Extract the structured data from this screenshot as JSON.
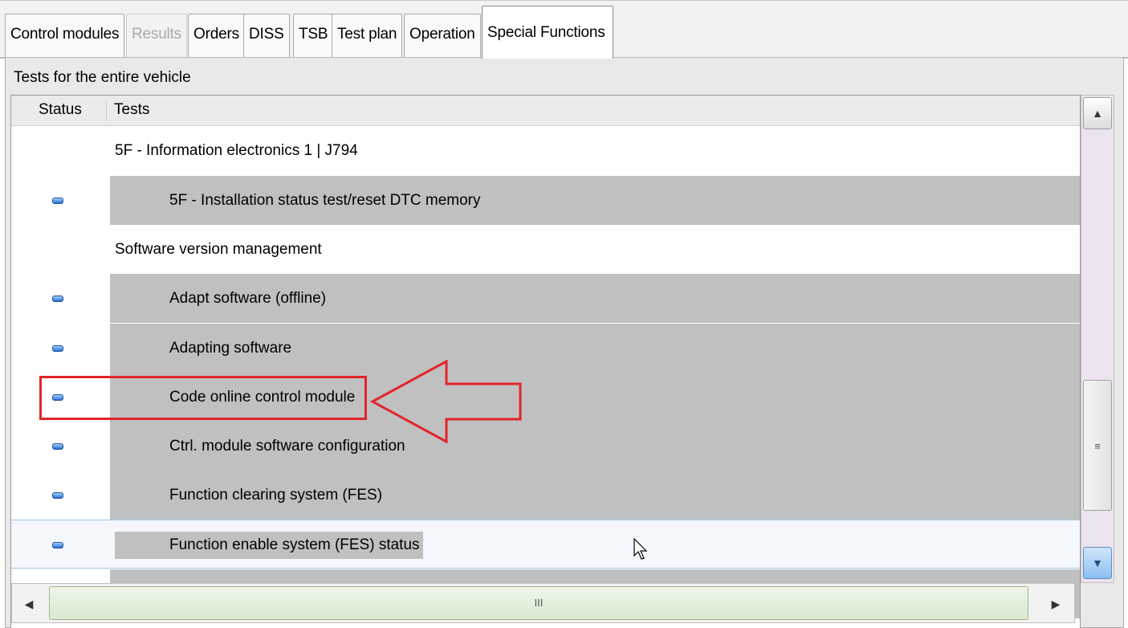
{
  "tabs": [
    {
      "label": "Control modules",
      "state": "normal"
    },
    {
      "label": "Results",
      "state": "disabled"
    },
    {
      "label": "Orders",
      "state": "normal"
    },
    {
      "label": "DISS",
      "state": "normal"
    },
    {
      "label": "TSB",
      "state": "normal"
    },
    {
      "label": "Test plan",
      "state": "normal"
    },
    {
      "label": "Operation",
      "state": "normal"
    },
    {
      "label": "Special Functions",
      "state": "active"
    }
  ],
  "panel": {
    "section_label": "Tests for the entire vehicle",
    "columns": {
      "status": "Status",
      "tests": "Tests"
    },
    "rows": [
      {
        "type": "group",
        "label": "5F - Information electronics 1 | J794"
      },
      {
        "type": "item",
        "label": "5F - Installation status test/reset DTC memory",
        "status": "blue-led"
      },
      {
        "type": "group",
        "label": "Software version management"
      },
      {
        "type": "item",
        "label": "Adapt software (offline)",
        "status": "blue-led"
      },
      {
        "type": "item",
        "label": "Adapting software",
        "status": "blue-led"
      },
      {
        "type": "item",
        "label": "Code online control module",
        "status": "blue-led",
        "annotated": true
      },
      {
        "type": "item",
        "label": "Ctrl. module software configuration",
        "status": "blue-led"
      },
      {
        "type": "item",
        "label": "Function clearing system (FES)",
        "status": "blue-led"
      },
      {
        "type": "item",
        "label": "Function enable system (FES) status",
        "status": "blue-led",
        "selected": true
      }
    ]
  },
  "scrollbars": {
    "vertical": {
      "up_icon": "chevron-up-icon",
      "down_icon": "chevron-down-icon",
      "thumb_grip": "≡"
    },
    "horizontal": {
      "left_icon": "arrow-left-icon",
      "right_icon": "arrow-right-icon",
      "thumb_grip": "III"
    }
  },
  "colors": {
    "item_highlight": "#c0c0c0",
    "annotation_red": "#e2242a",
    "status_led": "#2a6fd4",
    "selected_row": "#f4f8fc"
  }
}
